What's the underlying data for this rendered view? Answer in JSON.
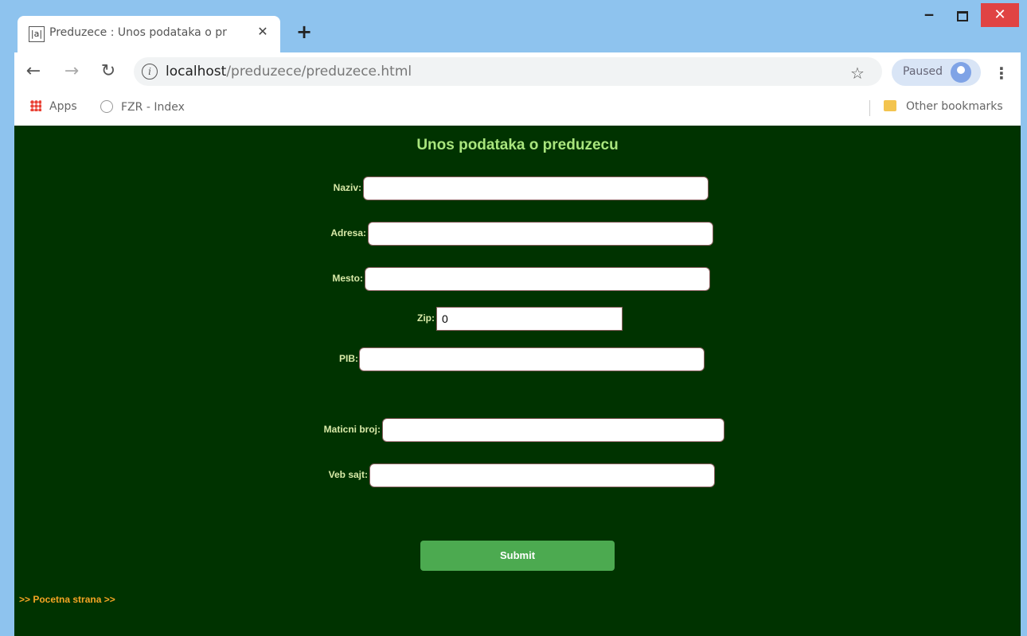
{
  "browser": {
    "tab_title": "Preduzece : Unos podataka o pr",
    "tab_favicon": "|a|",
    "tab_close": "✕",
    "new_tab": "+",
    "minimize": "‒",
    "close": "✕",
    "url_host": "localhost",
    "url_path": "/preduzece/preduzece.html",
    "profile_name": "Paused",
    "bookmarks": {
      "apps": "Apps",
      "fzr_index": "FZR - Index",
      "other": "Other bookmarks"
    },
    "icons": [
      "back-icon",
      "forward-icon",
      "reload-icon",
      "info-icon",
      "star-icon",
      "avatar",
      "menu-icon",
      "apps-icon",
      "folder-icon"
    ]
  },
  "form": {
    "title": "Unos podataka o preduzecu",
    "fields": {
      "naziv": {
        "label": "Naziv:",
        "value": ""
      },
      "adresa": {
        "label": "Adresa:",
        "value": ""
      },
      "mesto": {
        "label": "Mesto:",
        "value": ""
      },
      "zip": {
        "label": "Zip:",
        "value": "0"
      },
      "pib": {
        "label": "PIB:",
        "value": ""
      },
      "maticni": {
        "label": "Maticni broj:",
        "value": ""
      },
      "veb": {
        "label": "Veb sajt:",
        "value": ""
      }
    },
    "submit_label": "Submit",
    "home_link": ">> Pocetna strana >>"
  },
  "colors": {
    "page_bg": "#003300",
    "title": "#a9e57d",
    "labels": "#d9eaa8",
    "submit_bg": "#4caa50",
    "link": "#f5a524"
  }
}
